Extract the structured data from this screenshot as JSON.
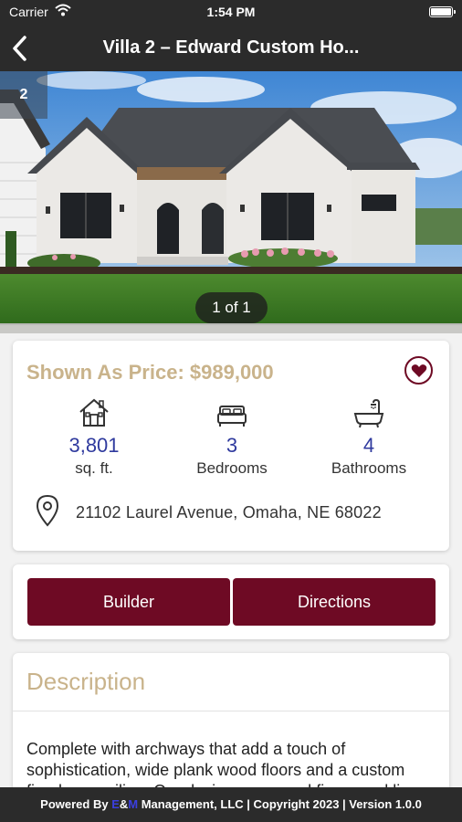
{
  "status_bar": {
    "carrier": "Carrier",
    "time": "1:54 PM",
    "wifi_icon": "wifi-icon",
    "battery_icon": "battery-icon"
  },
  "nav": {
    "back_icon": "chevron-left-icon",
    "title": "Villa 2 – Edward Custom Ho..."
  },
  "gallery": {
    "index_badge": "2",
    "counter": "1 of 1"
  },
  "listing": {
    "price": "Shown As Price: $989,000",
    "favorite_icon": "heart-icon",
    "stats": [
      {
        "icon": "house-icon",
        "value": "3,801",
        "label": "sq. ft."
      },
      {
        "icon": "bed-icon",
        "value": "3",
        "label": "Bedrooms"
      },
      {
        "icon": "bathtub-icon",
        "value": "4",
        "label": "Bathrooms"
      }
    ],
    "address_icon": "map-pin-icon",
    "address": "21102 Laurel Avenue, Omaha, NE 68022"
  },
  "actions": {
    "builder_label": "Builder",
    "directions_label": "Directions"
  },
  "description": {
    "title": "Description",
    "body": "Complete with archways that add a touch of sophistication, wide plank wood floors and a custom fireplace, ceiling. Our design, open and fine... and li..."
  },
  "footer": {
    "prefix": "Powered By ",
    "brand_e": "E",
    "amp": "&",
    "brand_m": "M",
    "suffix": " Management, LLC | Copyright 2023 | Version 1.0.0"
  },
  "colors": {
    "header_bg": "#2b2b2b",
    "accent_gold": "#c9b38b",
    "brand_maroon": "#6e0a24",
    "stat_blue": "#2f3a9e"
  }
}
